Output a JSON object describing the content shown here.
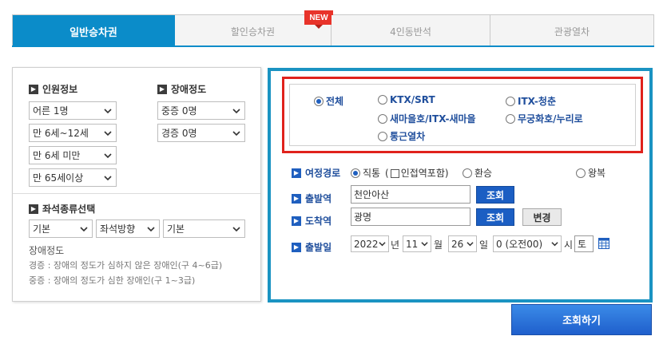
{
  "tabs": [
    {
      "label": "일반승차권",
      "active": true
    },
    {
      "label": "할인승차권",
      "active": false,
      "badge": "NEW"
    },
    {
      "label": "4인동반석",
      "active": false
    },
    {
      "label": "관광열차",
      "active": false
    }
  ],
  "passenger": {
    "title": "인원정보",
    "adult": "어른 1명",
    "child": "만 6세~12세",
    "infant": "만 6세 미만",
    "senior": "만 65세이상"
  },
  "disability": {
    "title": "장애정도",
    "severe": "중증 0명",
    "mild": "경증 0명"
  },
  "seat": {
    "title": "좌석종류선택",
    "type": "기본",
    "direction": "좌석방향",
    "position": "기본"
  },
  "disability_note": {
    "title": "장애정도",
    "mild_desc": "경증 : 장애의 정도가 심하지 않은 장애인(구 4~6급)",
    "severe_desc": "중증 : 장애의 정도가 심한 장애인(구 1~3급)"
  },
  "train_types": {
    "all": "전체",
    "ktx": "KTX/SRT",
    "itx_cheongchun": "ITX-청춘",
    "saemaeul": "새마을호/ITX-새마을",
    "mugunghwa": "무궁화호/누리로",
    "commuter": "통근열차"
  },
  "route": {
    "label": "여정경로",
    "direct": "직통",
    "adjacent": "인접역포함",
    "transfer": "환승",
    "round_trip": "왕복"
  },
  "departure": {
    "label": "출발역",
    "value": "천안아산",
    "button": "조회"
  },
  "arrival": {
    "label": "도착역",
    "value": "광명",
    "button": "조회",
    "swap_button": "변경"
  },
  "date": {
    "label": "출발일",
    "year": "2022",
    "year_unit": "년",
    "month": "11",
    "month_unit": "월",
    "day": "26",
    "day_unit": "일",
    "hour": "0 (오전00)",
    "hour_unit": "시",
    "weekday": "토"
  },
  "submit_button": "조회하기",
  "colors": {
    "tab_active": "#0b8cc9",
    "panel_border": "#1a93c2",
    "highlight_border": "#e0221c",
    "button_blue": "#1b5ec3",
    "label_blue": "#1f4e9c"
  }
}
